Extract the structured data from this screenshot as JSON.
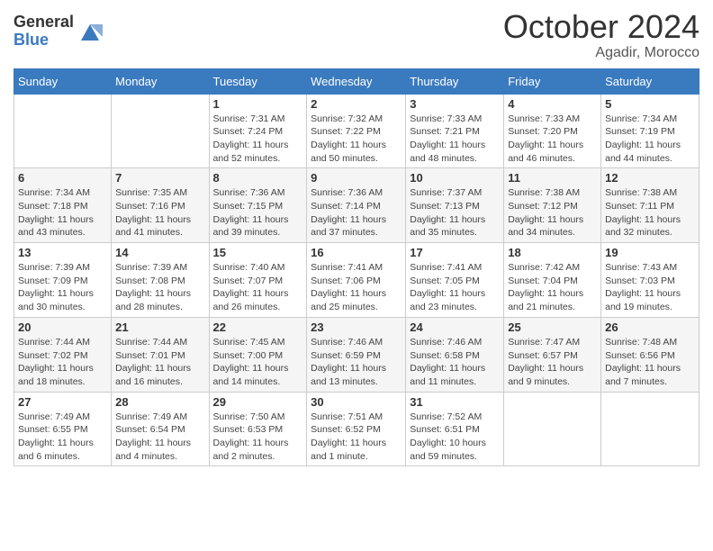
{
  "logo": {
    "general": "General",
    "blue": "Blue"
  },
  "title": "October 2024",
  "location": "Agadir, Morocco",
  "headers": [
    "Sunday",
    "Monday",
    "Tuesday",
    "Wednesday",
    "Thursday",
    "Friday",
    "Saturday"
  ],
  "weeks": [
    [
      {
        "day": "",
        "info": ""
      },
      {
        "day": "",
        "info": ""
      },
      {
        "day": "1",
        "info": "Sunrise: 7:31 AM\nSunset: 7:24 PM\nDaylight: 11 hours and 52 minutes."
      },
      {
        "day": "2",
        "info": "Sunrise: 7:32 AM\nSunset: 7:22 PM\nDaylight: 11 hours and 50 minutes."
      },
      {
        "day": "3",
        "info": "Sunrise: 7:33 AM\nSunset: 7:21 PM\nDaylight: 11 hours and 48 minutes."
      },
      {
        "day": "4",
        "info": "Sunrise: 7:33 AM\nSunset: 7:20 PM\nDaylight: 11 hours and 46 minutes."
      },
      {
        "day": "5",
        "info": "Sunrise: 7:34 AM\nSunset: 7:19 PM\nDaylight: 11 hours and 44 minutes."
      }
    ],
    [
      {
        "day": "6",
        "info": "Sunrise: 7:34 AM\nSunset: 7:18 PM\nDaylight: 11 hours and 43 minutes."
      },
      {
        "day": "7",
        "info": "Sunrise: 7:35 AM\nSunset: 7:16 PM\nDaylight: 11 hours and 41 minutes."
      },
      {
        "day": "8",
        "info": "Sunrise: 7:36 AM\nSunset: 7:15 PM\nDaylight: 11 hours and 39 minutes."
      },
      {
        "day": "9",
        "info": "Sunrise: 7:36 AM\nSunset: 7:14 PM\nDaylight: 11 hours and 37 minutes."
      },
      {
        "day": "10",
        "info": "Sunrise: 7:37 AM\nSunset: 7:13 PM\nDaylight: 11 hours and 35 minutes."
      },
      {
        "day": "11",
        "info": "Sunrise: 7:38 AM\nSunset: 7:12 PM\nDaylight: 11 hours and 34 minutes."
      },
      {
        "day": "12",
        "info": "Sunrise: 7:38 AM\nSunset: 7:11 PM\nDaylight: 11 hours and 32 minutes."
      }
    ],
    [
      {
        "day": "13",
        "info": "Sunrise: 7:39 AM\nSunset: 7:09 PM\nDaylight: 11 hours and 30 minutes."
      },
      {
        "day": "14",
        "info": "Sunrise: 7:39 AM\nSunset: 7:08 PM\nDaylight: 11 hours and 28 minutes."
      },
      {
        "day": "15",
        "info": "Sunrise: 7:40 AM\nSunset: 7:07 PM\nDaylight: 11 hours and 26 minutes."
      },
      {
        "day": "16",
        "info": "Sunrise: 7:41 AM\nSunset: 7:06 PM\nDaylight: 11 hours and 25 minutes."
      },
      {
        "day": "17",
        "info": "Sunrise: 7:41 AM\nSunset: 7:05 PM\nDaylight: 11 hours and 23 minutes."
      },
      {
        "day": "18",
        "info": "Sunrise: 7:42 AM\nSunset: 7:04 PM\nDaylight: 11 hours and 21 minutes."
      },
      {
        "day": "19",
        "info": "Sunrise: 7:43 AM\nSunset: 7:03 PM\nDaylight: 11 hours and 19 minutes."
      }
    ],
    [
      {
        "day": "20",
        "info": "Sunrise: 7:44 AM\nSunset: 7:02 PM\nDaylight: 11 hours and 18 minutes."
      },
      {
        "day": "21",
        "info": "Sunrise: 7:44 AM\nSunset: 7:01 PM\nDaylight: 11 hours and 16 minutes."
      },
      {
        "day": "22",
        "info": "Sunrise: 7:45 AM\nSunset: 7:00 PM\nDaylight: 11 hours and 14 minutes."
      },
      {
        "day": "23",
        "info": "Sunrise: 7:46 AM\nSunset: 6:59 PM\nDaylight: 11 hours and 13 minutes."
      },
      {
        "day": "24",
        "info": "Sunrise: 7:46 AM\nSunset: 6:58 PM\nDaylight: 11 hours and 11 minutes."
      },
      {
        "day": "25",
        "info": "Sunrise: 7:47 AM\nSunset: 6:57 PM\nDaylight: 11 hours and 9 minutes."
      },
      {
        "day": "26",
        "info": "Sunrise: 7:48 AM\nSunset: 6:56 PM\nDaylight: 11 hours and 7 minutes."
      }
    ],
    [
      {
        "day": "27",
        "info": "Sunrise: 7:49 AM\nSunset: 6:55 PM\nDaylight: 11 hours and 6 minutes."
      },
      {
        "day": "28",
        "info": "Sunrise: 7:49 AM\nSunset: 6:54 PM\nDaylight: 11 hours and 4 minutes."
      },
      {
        "day": "29",
        "info": "Sunrise: 7:50 AM\nSunset: 6:53 PM\nDaylight: 11 hours and 2 minutes."
      },
      {
        "day": "30",
        "info": "Sunrise: 7:51 AM\nSunset: 6:52 PM\nDaylight: 11 hours and 1 minute."
      },
      {
        "day": "31",
        "info": "Sunrise: 7:52 AM\nSunset: 6:51 PM\nDaylight: 10 hours and 59 minutes."
      },
      {
        "day": "",
        "info": ""
      },
      {
        "day": "",
        "info": ""
      }
    ]
  ]
}
